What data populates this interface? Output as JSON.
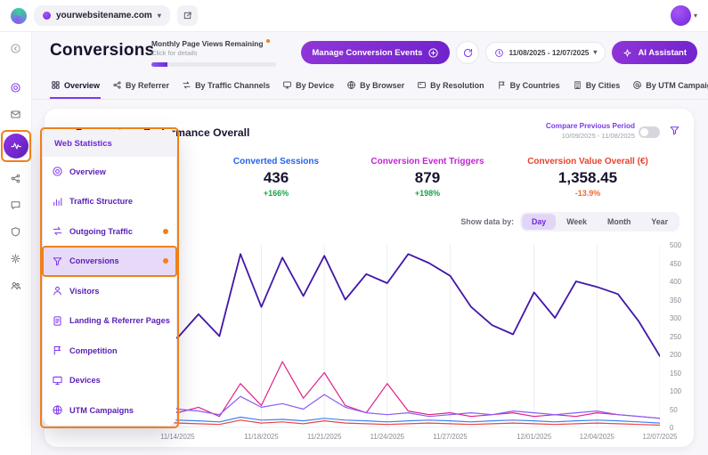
{
  "colors": {
    "accent": "#7c3aed",
    "annotation_orange": "#f08019",
    "positive_green": "#16a34a",
    "negative_orange": "#ef6c30"
  },
  "topbar": {
    "website": "yourwebsitename.com"
  },
  "sidebar": {
    "items": [
      {
        "icon": "collapse"
      },
      {
        "icon": "target",
        "tinted": true
      },
      {
        "icon": "mail"
      },
      {
        "icon": "pulse",
        "active": true
      },
      {
        "icon": "share"
      },
      {
        "icon": "chat"
      },
      {
        "icon": "shield"
      },
      {
        "icon": "gear"
      },
      {
        "icon": "users"
      }
    ]
  },
  "header": {
    "title": "Conversions",
    "page_views_label": "Monthly Page Views Remaining",
    "page_views_link": "Click for details",
    "manage_button": "Manage Conversion Events",
    "date_range": "11/08/2025 - 12/07/2025",
    "ai_assistant": "AI Assistant"
  },
  "tabs": [
    {
      "label": "Overview",
      "icon": "grid",
      "active": true
    },
    {
      "label": "By Referrer",
      "icon": "share"
    },
    {
      "label": "By Traffic Channels",
      "icon": "arrows"
    },
    {
      "label": "By Device",
      "icon": "monitor"
    },
    {
      "label": "By Browser",
      "icon": "globe"
    },
    {
      "label": "By Resolution",
      "icon": "screen"
    },
    {
      "label": "By Countries",
      "icon": "flag"
    },
    {
      "label": "By Cities",
      "icon": "building"
    },
    {
      "label": "By UTM Campaign",
      "icon": "at"
    }
  ],
  "card": {
    "title": "Conversions Performance Overall",
    "compare_label": "Compare Previous Period",
    "compare_range": "10/09/2025 - 11/08/2025",
    "show_data_by_label": "Show data by:",
    "granularity_options": [
      "Day",
      "Week",
      "Month",
      "Year"
    ],
    "granularity_active": "Day",
    "metrics": [
      {
        "label": "Converted Sessions",
        "value": "436",
        "delta": "+166%",
        "color": "#2563eb",
        "delta_color": "#16a34a"
      },
      {
        "label": "Conversion Event Triggers",
        "value": "879",
        "delta": "+198%",
        "color": "#c026d3",
        "delta_color": "#16a34a"
      },
      {
        "label": "Conversion Value Overall (€)",
        "value": "1,358.45",
        "delta": "-13.9%",
        "color": "#e8432e",
        "delta_color": "#ef6c30"
      }
    ]
  },
  "flyout": {
    "title": "Web Statistics",
    "items": [
      {
        "label": "Overview",
        "icon": "target"
      },
      {
        "label": "Traffic Structure",
        "icon": "bars"
      },
      {
        "label": "Outgoing Traffic",
        "icon": "arrows",
        "dot": true
      },
      {
        "label": "Conversions",
        "icon": "funnel",
        "dot": true,
        "active": true
      },
      {
        "label": "Visitors",
        "icon": "person"
      },
      {
        "label": "Landing & Referrer Pages",
        "icon": "doc"
      },
      {
        "label": "Competition",
        "icon": "flag"
      },
      {
        "label": "Devices",
        "icon": "monitor"
      },
      {
        "label": "UTM Campaigns",
        "icon": "globe"
      }
    ]
  },
  "chart_data": {
    "type": "line",
    "x_range": [
      "11/08/2025",
      "12/07/2025"
    ],
    "x_tick_labels": [
      "11/14/2025",
      "11/18/2025",
      "11/21/2025",
      "11/24/2025",
      "11/27/2025",
      "12/01/2025",
      "12/04/2025",
      "12/07/2025"
    ],
    "x_tick_indices": [
      6,
      10,
      13,
      16,
      19,
      23,
      26,
      29
    ],
    "ylim": [
      0,
      500
    ],
    "y_tick_step": 50,
    "grid": "vertical",
    "legend": "none",
    "series": [
      {
        "name": "dark-purple",
        "color": "#4316a8",
        "values": [
          345,
          300,
          330,
          290,
          320,
          260,
          245,
          310,
          250,
          475,
          330,
          465,
          360,
          470,
          350,
          420,
          395,
          475,
          450,
          415,
          330,
          280,
          255,
          370,
          300,
          400,
          385,
          365,
          290,
          195
        ]
      },
      {
        "name": "magenta",
        "color": "#e0218a",
        "values": [
          35,
          50,
          30,
          65,
          45,
          85,
          40,
          55,
          30,
          120,
          60,
          180,
          80,
          150,
          60,
          40,
          120,
          45,
          35,
          40,
          30,
          35,
          40,
          30,
          35,
          30,
          40,
          35,
          30,
          25
        ]
      },
      {
        "name": "purple",
        "color": "#8b5cf6",
        "values": [
          30,
          40,
          35,
          45,
          40,
          95,
          50,
          45,
          35,
          85,
          55,
          65,
          50,
          90,
          55,
          40,
          35,
          40,
          30,
          35,
          40,
          35,
          45,
          40,
          35,
          40,
          45,
          35,
          30,
          25
        ]
      },
      {
        "name": "blue",
        "color": "#3b82f6",
        "values": [
          18,
          20,
          15,
          22,
          18,
          25,
          20,
          18,
          15,
          28,
          20,
          22,
          18,
          25,
          20,
          18,
          15,
          18,
          20,
          18,
          15,
          18,
          20,
          18,
          15,
          18,
          20,
          18,
          15,
          12
        ]
      },
      {
        "name": "red",
        "color": "#ef4444",
        "values": [
          10,
          12,
          8,
          14,
          10,
          18,
          12,
          10,
          8,
          20,
          12,
          15,
          10,
          18,
          12,
          10,
          8,
          10,
          12,
          10,
          8,
          10,
          12,
          10,
          8,
          10,
          12,
          10,
          8,
          6
        ]
      }
    ]
  }
}
